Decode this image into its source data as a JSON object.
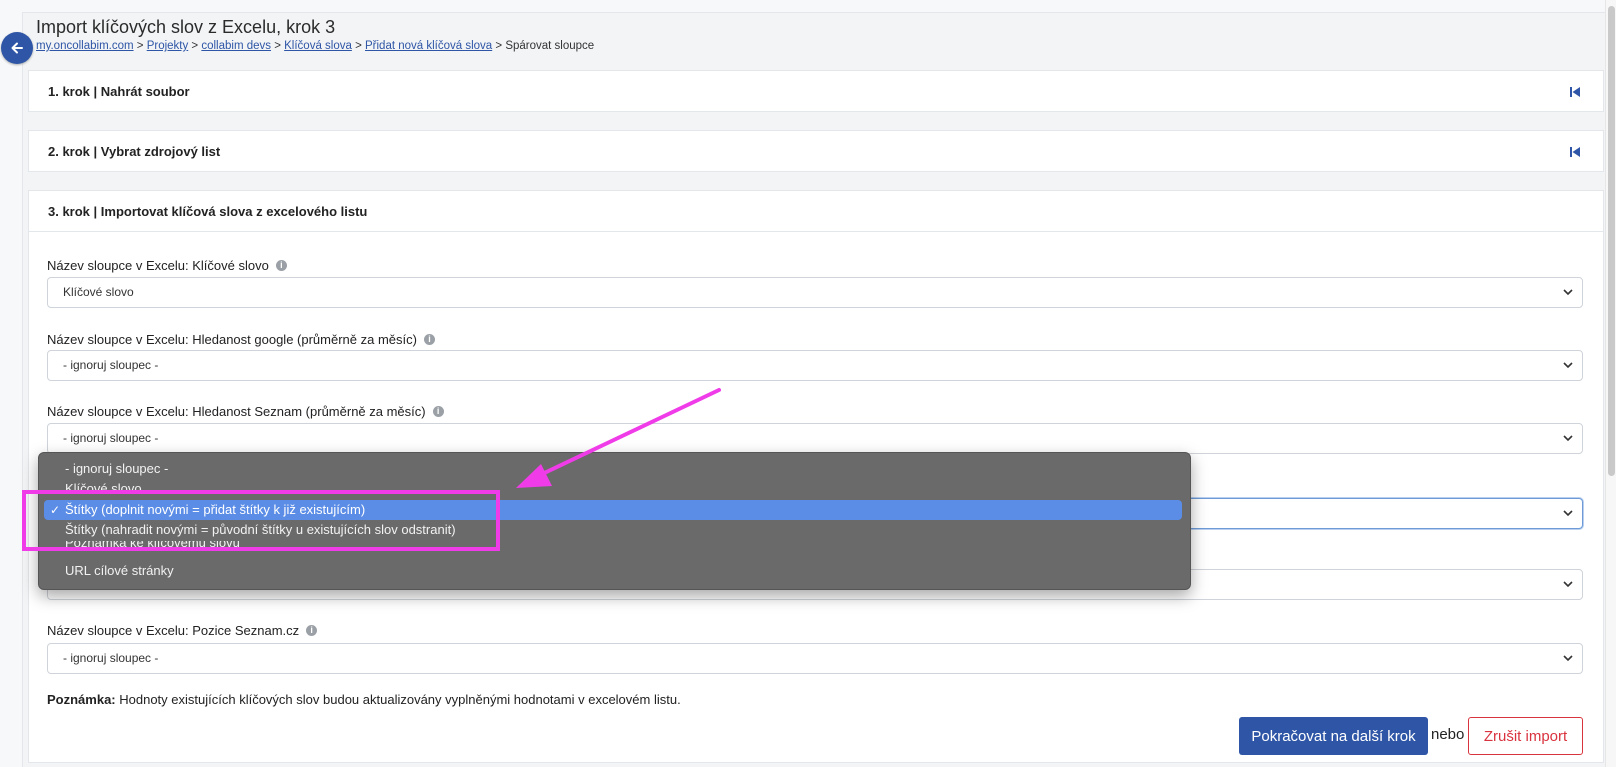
{
  "page": {
    "title": "Import klíčových slov z Excelu, krok 3",
    "back_icon": "arrow-left-icon"
  },
  "breadcrumb": {
    "items": [
      "my.oncollabim.com",
      "Projekty",
      "collabim devs",
      "Klíčová slova",
      "Přidat nová klíčová slova"
    ],
    "separator": " > ",
    "current": "Spárovat sloupce"
  },
  "steps": [
    {
      "label": "1. krok | Nahrát soubor",
      "icon": "skip-to-start-icon"
    },
    {
      "label": "2. krok | Vybrat zdrojový list",
      "icon": "skip-to-start-icon"
    },
    {
      "label": "3. krok | Importovat klíčová slova z excelového listu"
    }
  ],
  "fields": [
    {
      "label": "Název sloupce v Excelu: Klíčové slovo",
      "value": "Klíčové slovo"
    },
    {
      "label": "Název sloupce v Excelu: Hledanost google (průměrně za měsíc)",
      "value": "- ignoruj sloupec -"
    },
    {
      "label": "Název sloupce v Excelu: Hledanost Seznam (průměrně za měsíc)",
      "value": "- ignoruj sloupec -"
    },
    {
      "label": "",
      "value": ""
    },
    {
      "label": "",
      "value": ""
    },
    {
      "label": "Název sloupce v Excelu: Pozice Seznam.cz",
      "value": "- ignoruj sloupec -"
    }
  ],
  "dropdown": {
    "options": [
      "- ignoruj sloupec -",
      "Klíčové slovo",
      "Štítky (doplnit novými = přidat štítky k již existujícím)",
      "Štítky (nahradit novými = původní štítky u existujících slov odstranit)",
      "Poznámka ke klíčovému slovu",
      "URL cílové stránky"
    ],
    "selected_index": 2,
    "check_mark": "✓"
  },
  "note": {
    "bold": "Poznámka:",
    "text": " Hodnoty existujících klíčových slov budou aktualizovány vyplněnými hodnotami v excelovém listu."
  },
  "actions": {
    "continue_label": "Pokračovat na další krok",
    "or_label": "nebo",
    "cancel_label": "Zrušit import"
  },
  "colors": {
    "primary": "#2f56a6",
    "danger": "#d9333f",
    "dropdown_bg": "#6b6a6a",
    "dropdown_highlight": "#5b8de6",
    "annotation": "#f03ce8"
  }
}
